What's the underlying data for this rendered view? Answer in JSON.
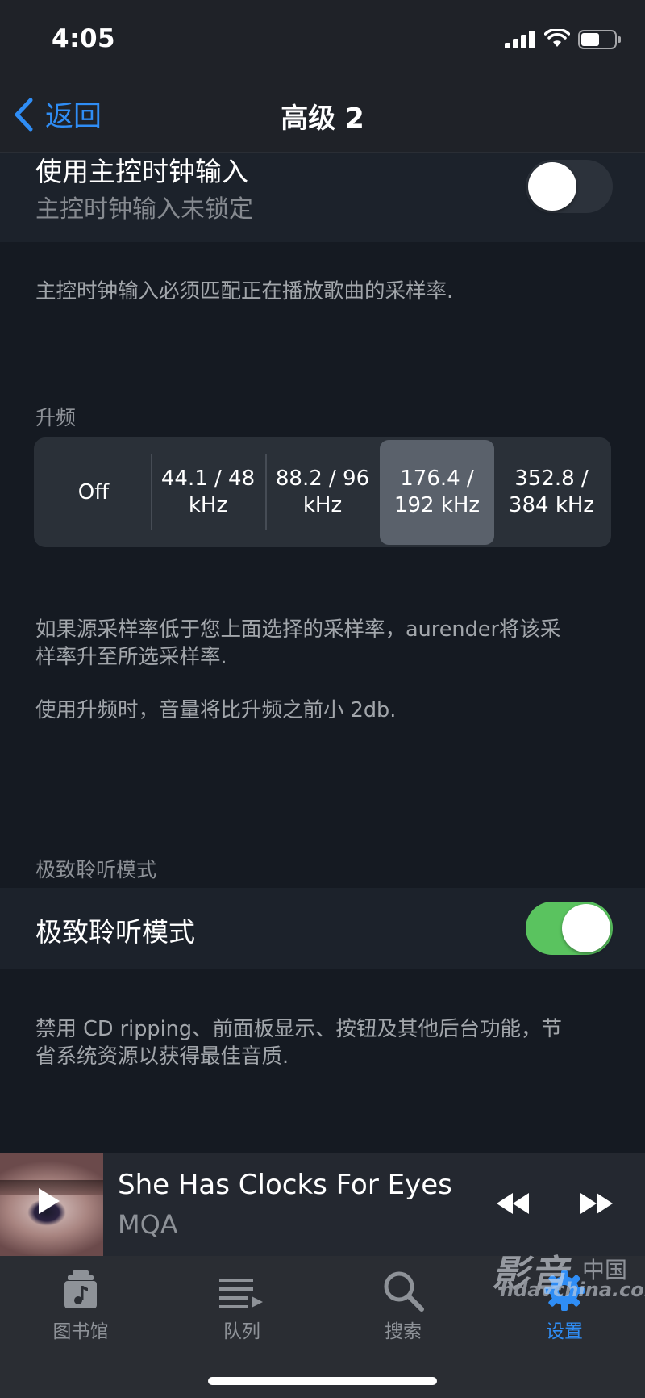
{
  "status_bar": {
    "time": "4:05"
  },
  "nav": {
    "back_label": "返回",
    "title": "高级 2"
  },
  "master_clock": {
    "title": "使用主控时钟输入",
    "subtitle": "主控时钟输入未锁定",
    "enabled": false,
    "description": "主控时钟输入必须匹配正在播放歌曲的采样率."
  },
  "upsampling": {
    "section_label": "升频",
    "options": [
      {
        "line1": "Off",
        "line2": ""
      },
      {
        "line1": "44.1 / 48",
        "line2": "kHz"
      },
      {
        "line1": "88.2 / 96",
        "line2": "kHz"
      },
      {
        "line1": "176.4 /",
        "line2": "192 kHz"
      },
      {
        "line1": "352.8 /",
        "line2": "384 kHz"
      }
    ],
    "selected_index": 3,
    "description_1a": "如果源采样率低于您上面选择的采样率，aurender将该采",
    "description_1b": "样率升至所选采样率.",
    "description_2": "使用升频时，音量将比升频之前小 2db."
  },
  "extreme_listening": {
    "section_label": "极致聆听模式",
    "title": "极致聆听模式",
    "enabled": true,
    "description_a": "禁用 CD ripping、前面板显示、按钮及其他后台功能，节",
    "description_b": "省系统资源以获得最佳音质."
  },
  "now_playing": {
    "title": "She Has Clocks For Eyes",
    "artist": "MQA"
  },
  "tabs": [
    {
      "label": "图书馆",
      "icon": "library-icon",
      "active": false
    },
    {
      "label": "队列",
      "icon": "queue-icon",
      "active": false
    },
    {
      "label": "搜索",
      "icon": "search-icon",
      "active": false
    },
    {
      "label": "设置",
      "icon": "settings-gear-icon",
      "active": true
    }
  ],
  "watermark": {
    "main": "影音",
    "sub": "hdavchina.com",
    "side": "中国"
  },
  "colors": {
    "accent": "#2f8df5",
    "switch_on": "#5ac35f",
    "background": "#151a22"
  }
}
